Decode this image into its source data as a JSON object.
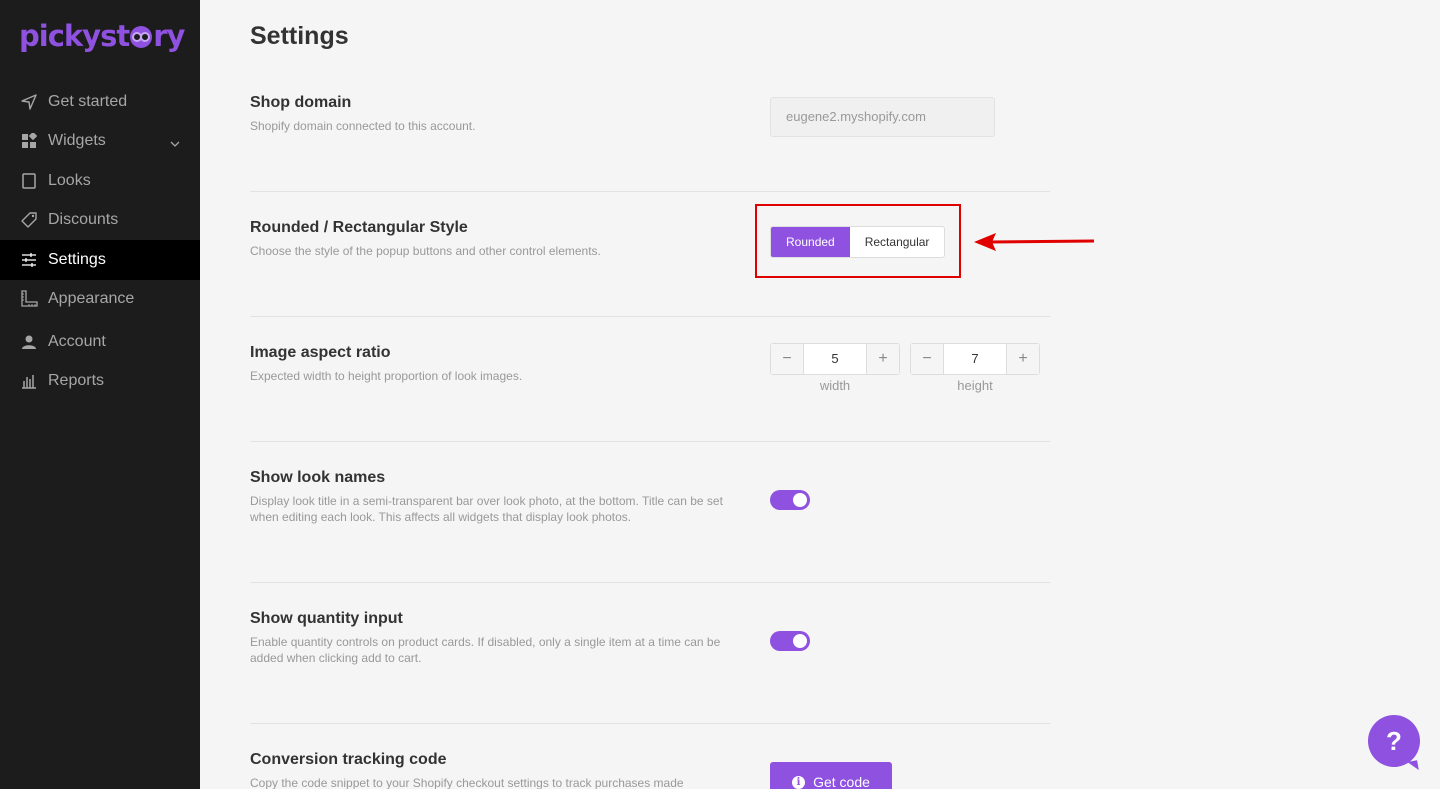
{
  "brand": {
    "name": "pickystory",
    "accent": "#8e51e0",
    "logo_prefix": "pickyst",
    "logo_suffix": "ry"
  },
  "sidebar": {
    "items": [
      {
        "label": "Get started",
        "icon": "send-icon"
      },
      {
        "label": "Widgets",
        "icon": "widgets-icon"
      },
      {
        "label": "Looks",
        "icon": "book-icon"
      },
      {
        "label": "Discounts",
        "icon": "tag-icon"
      },
      {
        "label": "Settings",
        "icon": "sliders-icon",
        "active": true
      },
      {
        "label": "Appearance",
        "icon": "ruler-icon"
      },
      {
        "label": "Account",
        "icon": "user-icon"
      },
      {
        "label": "Reports",
        "icon": "bar-chart-icon"
      }
    ]
  },
  "page": {
    "title": "Settings"
  },
  "settings": {
    "shop_domain": {
      "title": "Shop domain",
      "desc": "Shopify domain connected to this account.",
      "value": "eugene2.myshopify.com"
    },
    "style": {
      "title": "Rounded / Rectangular Style",
      "desc": "Choose the style of the popup buttons and other control elements.",
      "options": [
        "Rounded",
        "Rectangular"
      ],
      "selected": "Rounded"
    },
    "aspect": {
      "title": "Image aspect ratio",
      "desc": "Expected width to height proportion of look images.",
      "width_value": "5",
      "height_value": "7",
      "width_label": "width",
      "height_label": "height",
      "minus": "−",
      "plus": "+"
    },
    "look_names": {
      "title": "Show look names",
      "desc": "Display look title in a semi-transparent bar over look photo, at the bottom. Title can be set when editing each look. This affects all widgets that display look photos.",
      "enabled": true
    },
    "quantity": {
      "title": "Show quantity input",
      "desc": "Enable quantity controls on product cards. If disabled, only a single item at a time can be added when clicking add to cart.",
      "enabled": true
    },
    "tracking": {
      "title": "Conversion tracking code",
      "desc": "Copy the code snippet to your Shopify checkout settings to track purchases made",
      "button_label": "Get code"
    }
  },
  "help": {
    "label": "?"
  },
  "annotation": {
    "highlight_color": "#e00000"
  }
}
